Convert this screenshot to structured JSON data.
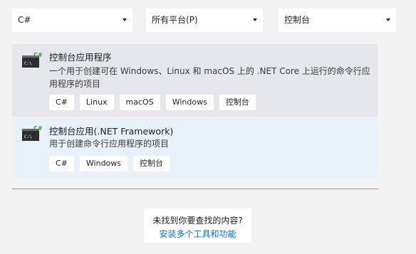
{
  "filters": {
    "language": "C#",
    "platform": "所有平台(P)",
    "project_type": "控制台"
  },
  "templates": [
    {
      "title": "控制台应用程序",
      "description": "一个用于创建可在 Windows、Linux 和 macOS 上的 .NET Core 上运行的命令行应用程序的项目",
      "tags": [
        "C#",
        "Linux",
        "macOS",
        "Windows",
        "控制台"
      ],
      "icon": "console-app-csharp-icon"
    },
    {
      "title": "控制台应用(.NET Framework)",
      "description": "用于创建命令行应用程序的项目",
      "tags": [
        "C#",
        "Windows",
        "控制台"
      ],
      "icon": "console-app-csharp-icon"
    }
  ],
  "help": {
    "question": "未找到你要查找的内容?",
    "link": "安装多个工具和功能"
  },
  "colors": {
    "selected_card": "#e4e6eb",
    "hover_card": "#e8f0fa",
    "link": "#0e70c0",
    "csharp_badge": "#3a9b3a"
  }
}
